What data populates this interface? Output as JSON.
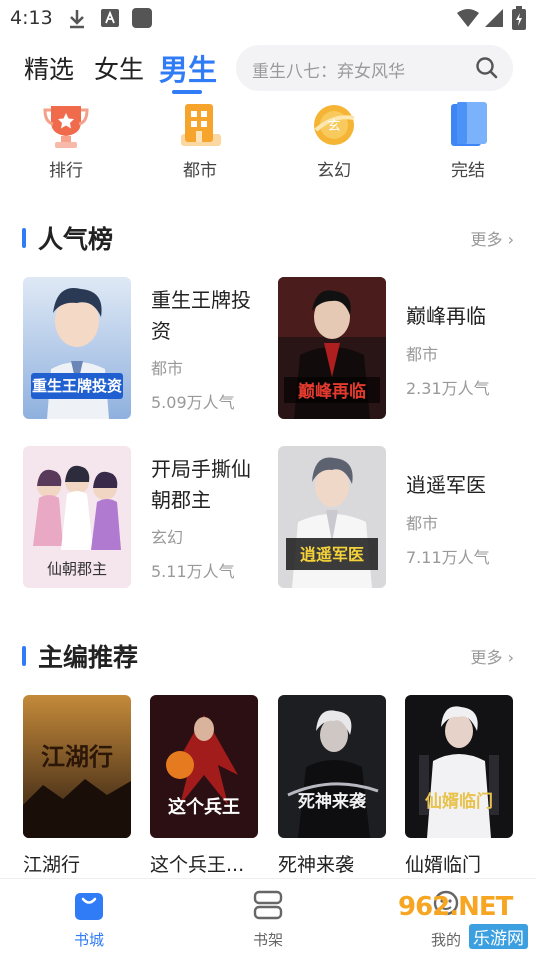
{
  "status_bar": {
    "time": "4:13",
    "icons": [
      "download-icon",
      "font-icon",
      "app-square-icon",
      "wifi-icon",
      "signal-icon",
      "battery-icon"
    ]
  },
  "nav": {
    "tabs": [
      {
        "label": "精选",
        "active": false
      },
      {
        "label": "女生",
        "active": false
      },
      {
        "label": "男生",
        "active": true
      }
    ],
    "search_placeholder": "重生八七：弃女风华"
  },
  "categories": [
    {
      "label": "排行",
      "icon": "trophy-icon"
    },
    {
      "label": "都市",
      "icon": "building-icon"
    },
    {
      "label": "玄幻",
      "icon": "fantasy-orb-icon"
    },
    {
      "label": "完结",
      "icon": "finished-book-icon"
    }
  ],
  "popular": {
    "title": "人气榜",
    "more": "更多",
    "items": [
      {
        "title": "重生王牌投资",
        "genre": "都市",
        "popularity": "5.09万人气",
        "cover_text": "重生王牌投资"
      },
      {
        "title": "巅峰再临",
        "genre": "都市",
        "popularity": "2.31万人气",
        "cover_text": "巅峰再临"
      },
      {
        "title": "开局手撕仙朝郡主",
        "genre": "玄幻",
        "popularity": "5.11万人气",
        "cover_text": "仙朝郡主"
      },
      {
        "title": "逍遥军医",
        "genre": "都市",
        "popularity": "7.11万人气",
        "cover_text": "逍遥军医"
      }
    ]
  },
  "editors": {
    "title": "主编推荐",
    "more": "更多",
    "items": [
      {
        "title": "江湖行",
        "cover_text": "江湖行"
      },
      {
        "title": "这个兵王...",
        "cover_text": "这个兵王"
      },
      {
        "title": "死神来袭",
        "cover_text": "死神来袭"
      },
      {
        "title": "仙婿临门",
        "cover_text": "仙婿临门"
      }
    ]
  },
  "bottom_nav": [
    {
      "label": "书城",
      "icon": "bookstore-icon",
      "active": true
    },
    {
      "label": "书架",
      "icon": "bookshelf-icon",
      "active": false
    },
    {
      "label": "我的",
      "icon": "profile-icon",
      "active": false
    }
  ],
  "watermark": {
    "text": "962.NET",
    "sub": "乐游网"
  },
  "colors": {
    "accent": "#2f7cf6",
    "muted": "#999999",
    "text": "#222222"
  }
}
